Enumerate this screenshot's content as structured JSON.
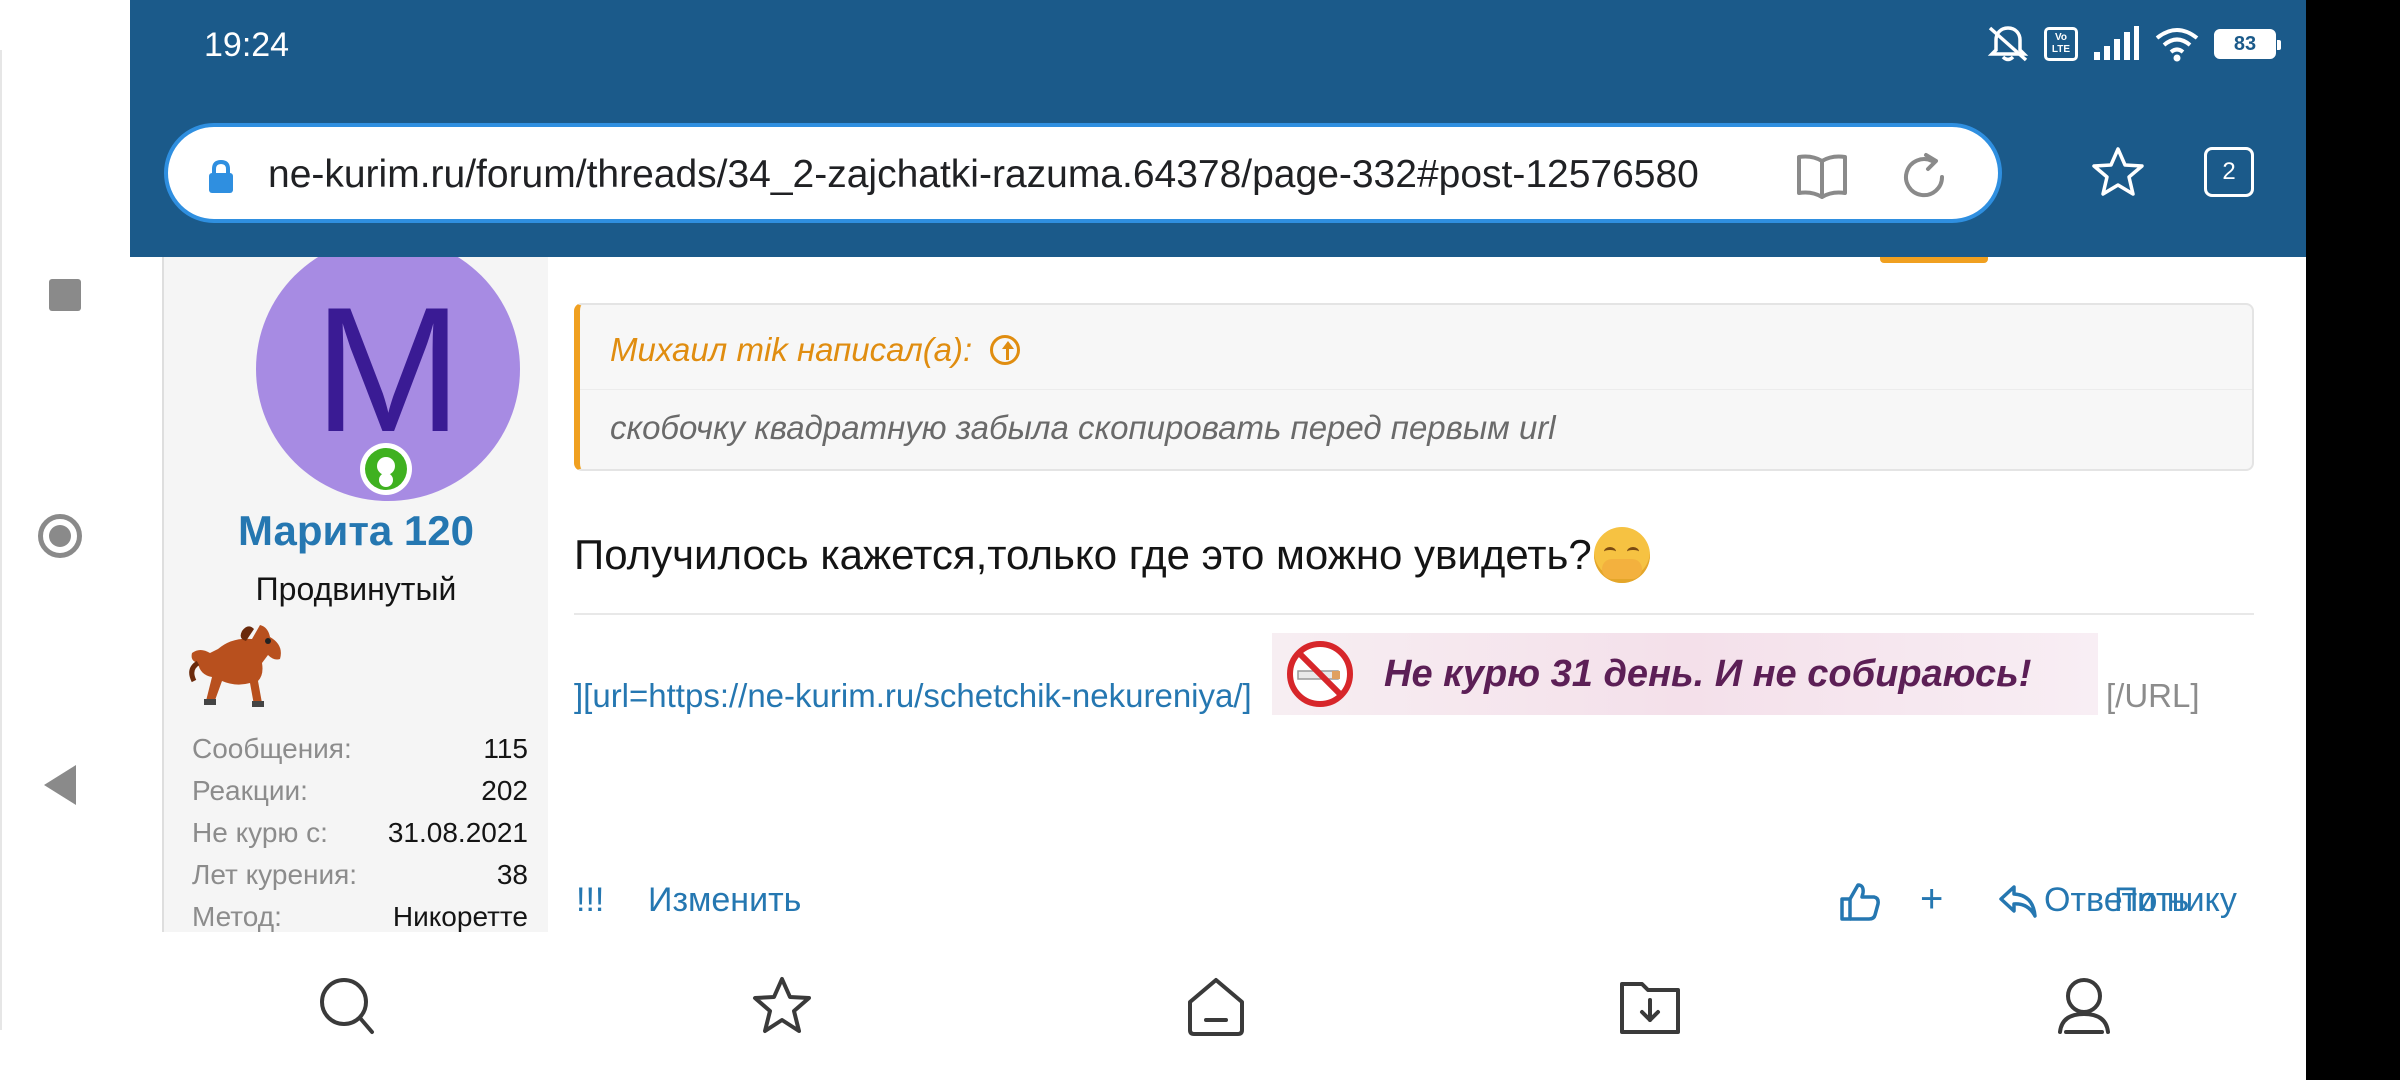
{
  "status_bar": {
    "time": "19:24",
    "battery": "83",
    "volte_label": "Vo LTE",
    "icons": [
      "mute-icon",
      "volte-icon",
      "signal-icon",
      "wifi-icon",
      "battery-icon"
    ]
  },
  "browser": {
    "url": "ne-kurim.ru/forum/threads/34_2-zajchatki-razuma.64378/page-332#post-12576580",
    "tab_count": "2"
  },
  "user": {
    "avatar_letter": "M",
    "name": "Марита 120",
    "title": "Продвинутый",
    "stats": [
      {
        "label": "Сообщения:",
        "value": "115"
      },
      {
        "label": "Реакции:",
        "value": "202"
      },
      {
        "label": "Не курю с:",
        "value": "31.08.2021"
      },
      {
        "label": "Лет курения:",
        "value": "38"
      },
      {
        "label": "Метод:",
        "value": "Никоретте"
      }
    ]
  },
  "post": {
    "quote": {
      "author": "Михаил mik написал(а):",
      "text": "скобочку квадратную забыла скопировать перед первым url"
    },
    "message": "Получилось кажется,только где это можно увидеть?",
    "signature": {
      "link_text": "][url=https://ne-kurim.ru/schetchik-nekureniya/]",
      "banner_text": "Не курю 31 день. И не собираюсь!",
      "end_text": "[/URL]"
    },
    "actions": {
      "exclaim": "!!!",
      "edit": "Изменить",
      "plus": "+",
      "reply": "Ответить",
      "by_nick": "По нику"
    }
  },
  "colors": {
    "header": "#1b5a8a",
    "url_border": "#2f8fe0",
    "link": "#2577b1",
    "quote_accent": "#f0a020",
    "avatar_bg": "#a78be3",
    "avatar_fg": "#3a1b94",
    "online": "#3fb120"
  }
}
